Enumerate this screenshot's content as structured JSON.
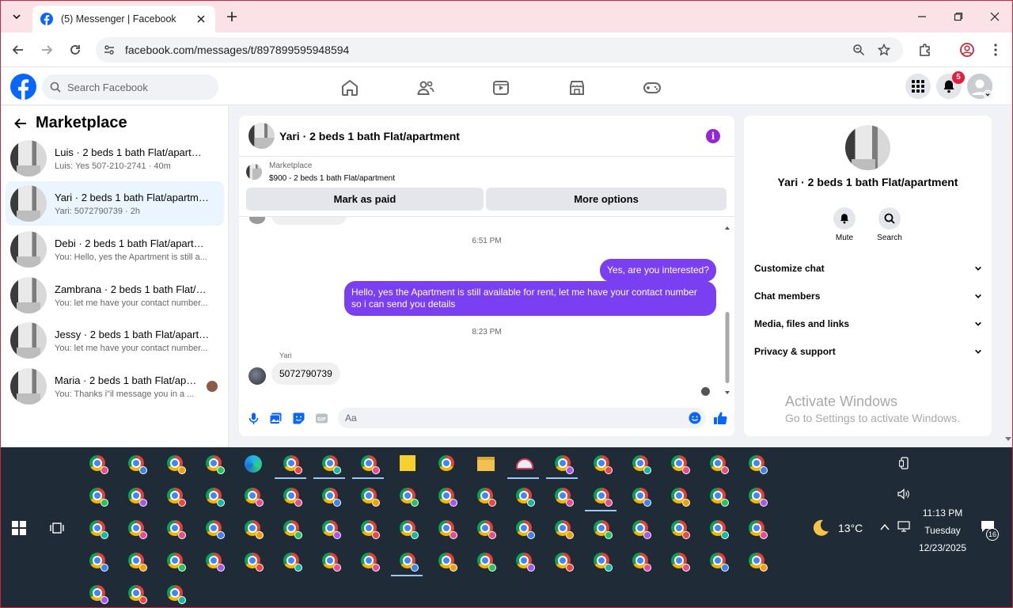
{
  "browser": {
    "tab_title": "(5) Messenger | Facebook",
    "url": "facebook.com/messages/t/897899595948594"
  },
  "facebook": {
    "search_placeholder": "Search Facebook",
    "notification_count": "5"
  },
  "sidebar": {
    "title": "Marketplace",
    "chats": [
      {
        "name": "Luis · 2 beds 1 bath Flat/apartment",
        "preview": "Luis: Yes 507-210-2741 · 40m"
      },
      {
        "name": "Yari · 2 beds 1 bath Flat/apartment",
        "preview": "Yari: 5072790739 · 2h"
      },
      {
        "name": "Debi · 2 beds 1 bath Flat/apartment",
        "preview": "You: Hello, yes the Apartment is still a... · 4h"
      },
      {
        "name": "Zambrana · 2 beds 1 bath Flat/apa...",
        "preview": "You: let me have your contact number... · 4h"
      },
      {
        "name": "Jessy · 2 beds 1 bath Flat/apartment",
        "preview": "You: let me have your contact number... · 4h"
      },
      {
        "name": "Maria · 2 beds 1 bath Flat/apart...",
        "preview": "You: Thanks i\"il message you in a ... · 6w"
      }
    ]
  },
  "conversation": {
    "title": "Yari · 2 beds 1 bath Flat/apartment",
    "listing_source": "Marketplace",
    "listing": "$900 - 2 beds 1 bath Flat/apartment",
    "mark_paid_label": "Mark as paid",
    "more_options_label": "More options",
    "timestamp_1": "6:51 PM",
    "msg_out_1": "Yes, are you interested?",
    "msg_out_2": "Hello, yes the Apartment is still available for rent, let me have your contact number so i can send you details",
    "timestamp_2": "8:23 PM",
    "sender_name": "Yari",
    "msg_in_1": "5072790739",
    "composer_placeholder": "Aa"
  },
  "info_panel": {
    "name": "Yari · 2 beds 1 bath Flat/apartment",
    "mute_label": "Mute",
    "search_label": "Search",
    "sections": [
      "Customize chat",
      "Chat members",
      "Media, files and links",
      "Privacy & support"
    ]
  },
  "watermark": {
    "line1": "Activate Windows",
    "line2": "Go to Settings to activate Windows."
  },
  "taskbar": {
    "temperature": "13°C",
    "time": "11:13 PM",
    "day": "Tuesday",
    "date": "12/23/2025",
    "notification_count": "16"
  },
  "colors": {
    "messenger_purple": "#7b3ff2",
    "facebook_blue": "#0866ff",
    "notification_red": "#e41e3f",
    "window_border": "#c9283e"
  }
}
